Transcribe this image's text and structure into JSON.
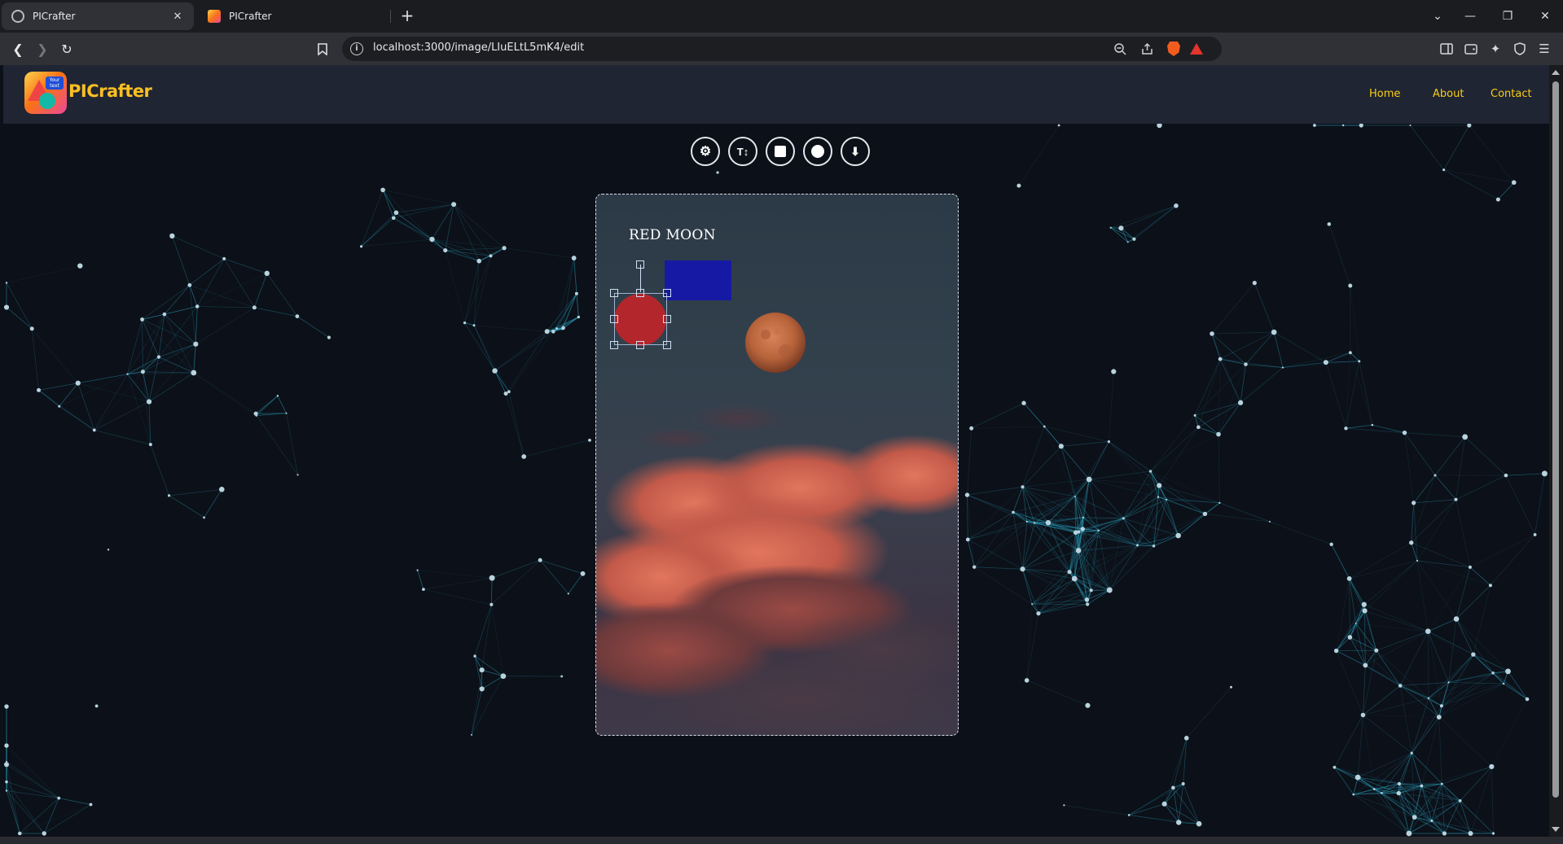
{
  "browser": {
    "tabs": [
      {
        "title": "PICrafter",
        "active": true
      },
      {
        "title": "PICrafter",
        "active": false
      }
    ],
    "url": "localhost:3000/image/LIuELtL5mK4/edit",
    "new_tab_symbol": "+",
    "close_symbol": "✕"
  },
  "site": {
    "brand": "PICrafter",
    "logo_text": "Your text",
    "nav": [
      {
        "label": "Home"
      },
      {
        "label": "About"
      },
      {
        "label": "Contact"
      }
    ],
    "accent_color": "#facc15"
  },
  "editor": {
    "tools": [
      {
        "name": "settings",
        "icon": "gear-icon",
        "glyph": "⚙"
      },
      {
        "name": "text",
        "icon": "text-size-icon",
        "glyph": "T↕"
      },
      {
        "name": "rectangle",
        "icon": "square-icon",
        "glyph": ""
      },
      {
        "name": "circle",
        "icon": "circle-icon",
        "glyph": ""
      },
      {
        "name": "download",
        "icon": "download-icon",
        "glyph": "⬇"
      }
    ],
    "canvas": {
      "title_text": "RED MOON",
      "rect_color": "#1619a4",
      "circle_color": "#b3262b",
      "moon_color": "#b8643b"
    }
  }
}
